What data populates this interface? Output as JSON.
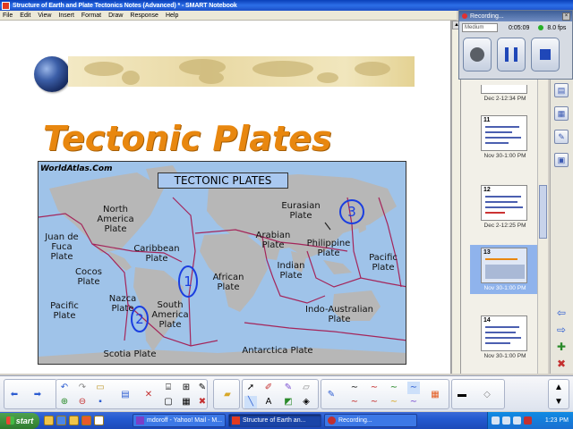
{
  "window": {
    "title": "Structure of Earth and Plate Tectonics Notes (Advanced) * - SMART Notebook"
  },
  "menu": [
    "File",
    "Edit",
    "View",
    "Insert",
    "Format",
    "Draw",
    "Response",
    "Help"
  ],
  "slide": {
    "heading": "Tectonic Plates",
    "map": {
      "source_credit": "WorldAtlas.Com",
      "title": "TECTONIC PLATES",
      "labels": [
        "North America Plate",
        "Juan de Fuca Plate",
        "Caribbean Plate",
        "Cocos Plate",
        "Nazca Plate",
        "South America Plate",
        "Pacific Plate",
        "Scotia Plate",
        "African Plate",
        "Arabian Plate",
        "Eurasian Plate",
        "Indian Plate",
        "Philippine Plate",
        "Pacific Plate",
        "Indo-Australian Plate",
        "Antarctica Plate"
      ],
      "annotations": [
        "1",
        "2",
        "3"
      ]
    }
  },
  "recorder": {
    "title": "Recording...",
    "format": "Medium",
    "elapsed": "0:05:09",
    "fps": "8.0 fps"
  },
  "page_sorter": {
    "thumbs": [
      {
        "number": "",
        "caption": "Dec 2-12:34 PM"
      },
      {
        "number": "11",
        "caption": "Nov 30-1:00 PM"
      },
      {
        "number": "12",
        "caption": "Dec 2-12:25 PM"
      },
      {
        "number": "13",
        "caption": "Nov 30-1:00 PM"
      },
      {
        "number": "14",
        "caption": "Nov 30-1:00 PM"
      }
    ],
    "selected_index": 3
  },
  "taskbar": {
    "start_label": "start",
    "tasks": [
      {
        "label": "mdoroff - Yahoo! Mail - M...",
        "active": false
      },
      {
        "label": "Structure of Earth an...",
        "active": true
      },
      {
        "label": "Recording...",
        "active": false
      }
    ],
    "clock": "1:23 PM"
  },
  "colors": {
    "heading": "#e8870f",
    "ink": "#1a3ee0",
    "plate_boundary": "#a4255a",
    "titlebar": "#0a3fb8"
  }
}
